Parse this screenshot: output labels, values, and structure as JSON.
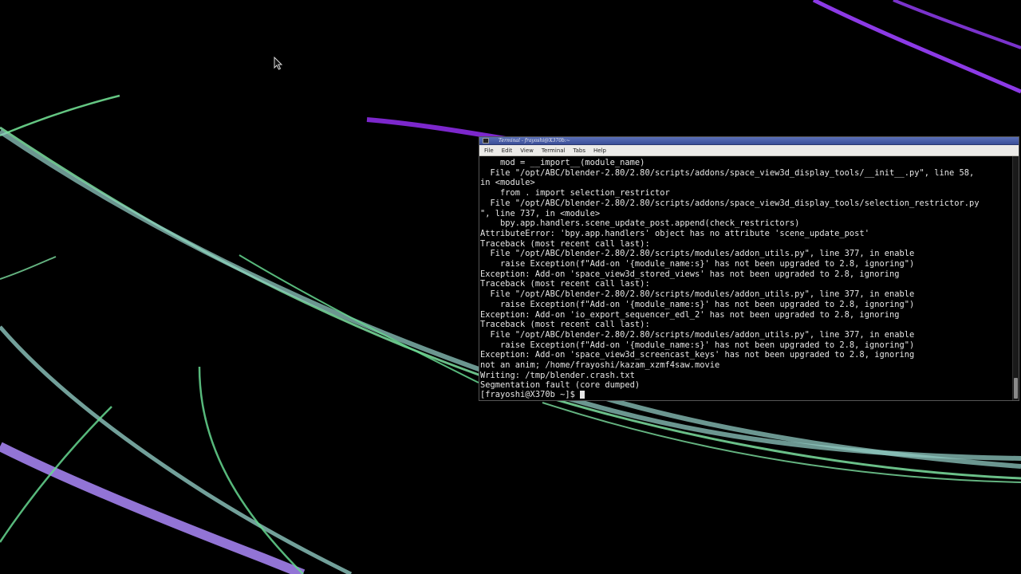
{
  "terminal": {
    "title": "Terminal - frayoshi@X370b:~",
    "menu": [
      "File",
      "Edit",
      "View",
      "Terminal",
      "Tabs",
      "Help"
    ],
    "output_lines": [
      "    mod = __import__(module_name)",
      "  File \"/opt/ABC/blender-2.80/2.80/scripts/addons/space_view3d_display_tools/__init__.py\", line 58,",
      "in <module>",
      "    from . import selection_restrictor",
      "  File \"/opt/ABC/blender-2.80/2.80/scripts/addons/space_view3d_display_tools/selection_restrictor.py",
      "\", line 737, in <module>",
      "    bpy.app.handlers.scene_update_post.append(check_restrictors)",
      "AttributeError: 'bpy.app.handlers' object has no attribute 'scene_update_post'",
      "Traceback (most recent call last):",
      "  File \"/opt/ABC/blender-2.80/2.80/scripts/modules/addon_utils.py\", line 377, in enable",
      "    raise Exception(f\"Add-on '{module_name:s}' has not been upgraded to 2.8, ignoring\")",
      "Exception: Add-on 'space_view3d_stored_views' has not been upgraded to 2.8, ignoring",
      "Traceback (most recent call last):",
      "  File \"/opt/ABC/blender-2.80/2.80/scripts/modules/addon_utils.py\", line 377, in enable",
      "    raise Exception(f\"Add-on '{module_name:s}' has not been upgraded to 2.8, ignoring\")",
      "Exception: Add-on 'io_export_sequencer_edl_2' has not been upgraded to 2.8, ignoring",
      "Traceback (most recent call last):",
      "  File \"/opt/ABC/blender-2.80/2.80/scripts/modules/addon_utils.py\", line 377, in enable",
      "    raise Exception(f\"Add-on '{module_name:s}' has not been upgraded to 2.8, ignoring\")",
      "Exception: Add-on 'space_view3d_screencast_keys' has not been upgraded to 2.8, ignoring",
      "not an anim; /home/frayoshi/kazam_xzmf4saw.movie",
      "Writing: /tmp/blender.crash.txt",
      "Segmentation fault (core dumped)"
    ],
    "prompt": "[frayoshi@X370b ~]$"
  },
  "wallpaper": {
    "colors": {
      "background": "#000000",
      "green": "#7fe0a0",
      "teal": "#8fc8c0",
      "purple": "#a060ff",
      "violet": "#9a7ae0"
    }
  }
}
